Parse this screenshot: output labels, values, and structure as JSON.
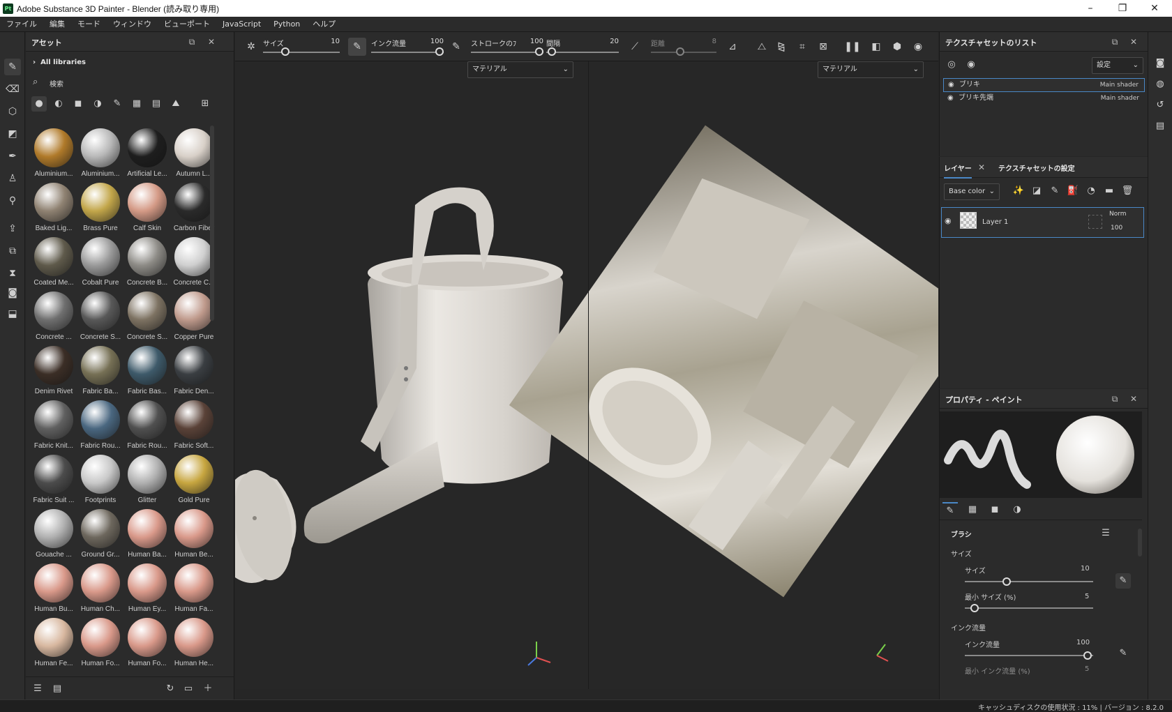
{
  "window": {
    "title": "Adobe Substance 3D Painter - Blender (読み取り専用)",
    "app_icon": "Pt"
  },
  "menu": [
    "ファイル",
    "編集",
    "モード",
    "ウィンドウ",
    "ビューポート",
    "JavaScript",
    "Python",
    "ヘルプ"
  ],
  "assets": {
    "title": "アセット",
    "library": "All libraries",
    "search_placeholder": "検索",
    "items": [
      {
        "label": "Aluminium...",
        "color": "#b07a2a"
      },
      {
        "label": "Aluminium...",
        "color": "#b8b8b8"
      },
      {
        "label": "Artificial Le...",
        "color": "#1e1e1e"
      },
      {
        "label": "Autumn L...",
        "color": "#d8d0c8"
      },
      {
        "label": "Baked Lig...",
        "color": "#8f8272"
      },
      {
        "label": "Brass Pure",
        "color": "#c2a64a"
      },
      {
        "label": "Calf Skin",
        "color": "#d49a86"
      },
      {
        "label": "Carbon Fiber",
        "color": "#2a2a2a"
      },
      {
        "label": "Coated Me...",
        "color": "#5f5a4b"
      },
      {
        "label": "Cobalt Pure",
        "color": "#9a9a9a"
      },
      {
        "label": "Concrete B...",
        "color": "#8d8b86"
      },
      {
        "label": "Concrete C...",
        "color": "#cfcfcf"
      },
      {
        "label": "Concrete ...",
        "color": "#6f6f6f"
      },
      {
        "label": "Concrete S...",
        "color": "#585858"
      },
      {
        "label": "Concrete S...",
        "color": "#7d7262"
      },
      {
        "label": "Copper Pure",
        "color": "#bf9a8c"
      },
      {
        "label": "Denim Rivet",
        "color": "#3b2e26"
      },
      {
        "label": "Fabric Ba...",
        "color": "#767055"
      },
      {
        "label": "Fabric Bas...",
        "color": "#3e5a6a"
      },
      {
        "label": "Fabric Den...",
        "color": "#3a3e42"
      },
      {
        "label": "Fabric Knit...",
        "color": "#606060"
      },
      {
        "label": "Fabric Rou...",
        "color": "#4a6780"
      },
      {
        "label": "Fabric Rou...",
        "color": "#505050"
      },
      {
        "label": "Fabric Soft...",
        "color": "#5a4238"
      },
      {
        "label": "Fabric Suit ...",
        "color": "#4c4c4c"
      },
      {
        "label": "Footprints",
        "color": "#c8c8c8"
      },
      {
        "label": "Glitter",
        "color": "#b0b0b0"
      },
      {
        "label": "Gold Pure",
        "color": "#c7a640"
      },
      {
        "label": "Gouache ...",
        "color": "#b0b0b0"
      },
      {
        "label": "Ground Gr...",
        "color": "#6d675d"
      },
      {
        "label": "Human Ba...",
        "color": "#d9998a"
      },
      {
        "label": "Human Be...",
        "color": "#d9998a"
      },
      {
        "label": "Human Bu...",
        "color": "#d9998a"
      },
      {
        "label": "Human Ch...",
        "color": "#d9998a"
      },
      {
        "label": "Human Ey...",
        "color": "#d9998a"
      },
      {
        "label": "Human Fa...",
        "color": "#d9998a"
      },
      {
        "label": "Human Fe...",
        "color": "#d8b8a0"
      },
      {
        "label": "Human Fo...",
        "color": "#d9998a"
      },
      {
        "label": "Human Fo...",
        "color": "#d9998a"
      },
      {
        "label": "Human He...",
        "color": "#d9998a"
      }
    ]
  },
  "toolbar": {
    "size_label": "サイズ",
    "size_value": "10",
    "flow_label": "インク流量",
    "flow_value": "100",
    "stroke_label": "ストロークのﾌ",
    "stroke_value": "100",
    "spacing_label": "間隔",
    "spacing_value": "20",
    "distance_label": "距離",
    "distance_value": "8"
  },
  "viewport": {
    "left_dropdown": "マテリアル",
    "right_dropdown": "マテリアル"
  },
  "texture_sets": {
    "title": "テクスチャセットのリスト",
    "settings_dropdown": "設定",
    "rows": [
      {
        "name": "ブリキ",
        "shader": "Main shader"
      },
      {
        "name": "ブリキ先端",
        "shader": "Main shader"
      }
    ]
  },
  "layers": {
    "tab_layers": "レイヤー",
    "tab_settings": "テクスチャセットの設定",
    "channel": "Base color",
    "layer_name": "Layer 1",
    "blend": "Norm",
    "opacity": "100"
  },
  "properties": {
    "title": "プロパティ - ペイント",
    "section": "ブラシ",
    "size_group": "サイズ",
    "size_label": "サイズ",
    "size_value": "10",
    "min_size_label": "最小 サイズ (%)",
    "min_size_value": "5",
    "flow_group": "インク流量",
    "flow_label": "インク流量",
    "flow_value": "100",
    "min_flow_label": "最小 インク流量 (%)",
    "min_flow_value": "5"
  },
  "status": "キャッシュディスクの使用状況 : 11% | バージョン : 8.2.0"
}
